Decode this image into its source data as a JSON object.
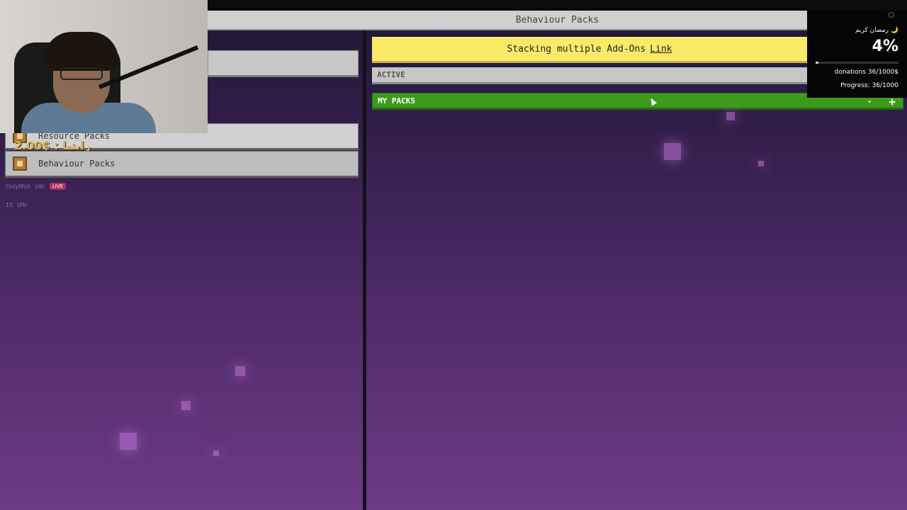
{
  "window": {
    "title": "Behaviour Packs"
  },
  "sidebar": {
    "items": [
      {
        "label": "Resource Packs"
      },
      {
        "label": "Behaviour Packs"
      }
    ]
  },
  "overlay": {
    "price_text": "رايتيا : $2.00",
    "chat": [
      {
        "user": "OnlyMuh",
        "badge": "Ultr",
        "tag": "LIVE"
      },
      {
        "user": "1S",
        "badge": "Ultr"
      }
    ]
  },
  "main": {
    "banner": {
      "text": "Stacking multiple Add-Ons",
      "link": "Link"
    },
    "sections": {
      "active": "ACTIVE",
      "my_packs": "MY PACKS",
      "add_icon": "+",
      "chevron_icon": "⌄"
    }
  },
  "donation_widget": {
    "greeting": "رمضان كريم 🌙",
    "percent": "4%",
    "progress_fraction": 0.036,
    "donations": "donations 36/1000$",
    "progress": "Progress: 36/1000"
  },
  "colors": {
    "banner": "#fbe96a",
    "my_packs": "#3c9a1c",
    "background_top": "#1f1530",
    "background_bottom": "#6e3a86"
  }
}
